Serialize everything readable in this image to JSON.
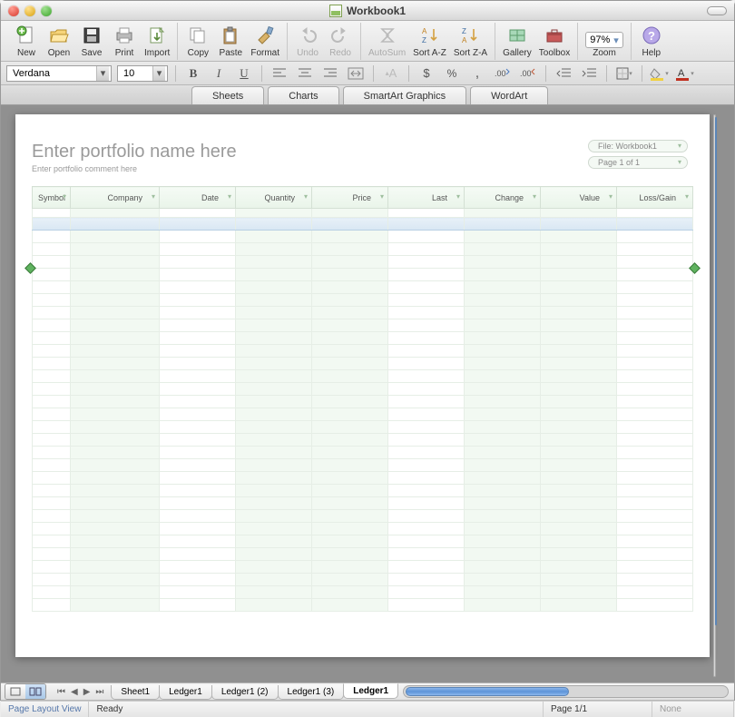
{
  "window": {
    "title": "Workbook1"
  },
  "toolbar": {
    "new": "New",
    "open": "Open",
    "save": "Save",
    "print": "Print",
    "import": "Import",
    "copy": "Copy",
    "paste": "Paste",
    "format": "Format",
    "undo": "Undo",
    "redo": "Redo",
    "autosum": "AutoSum",
    "sortaz": "Sort A-Z",
    "sortza": "Sort Z-A",
    "gallery": "Gallery",
    "toolbox": "Toolbox",
    "zoom": "Zoom",
    "zoom_value": "97%",
    "help": "Help"
  },
  "format": {
    "font": "Verdana",
    "size": "10"
  },
  "toptabs": {
    "sheets": "Sheets",
    "charts": "Charts",
    "smartart": "SmartArt Graphics",
    "wordart": "WordArt"
  },
  "page": {
    "title": "Enter portfolio name here",
    "subtitle": "Enter portfolio comment here",
    "meta_file": "File: Workbook1",
    "meta_page": "Page 1 of 1"
  },
  "columns": {
    "symbol": "Symbol",
    "company": "Company",
    "date": "Date",
    "quantity": "Quantity",
    "price": "Price",
    "last": "Last",
    "change": "Change",
    "value": "Value",
    "lossgain": "Loss/Gain"
  },
  "sheets": {
    "s1": "Sheet1",
    "s2": "Ledger1",
    "s3": "Ledger1 (2)",
    "s4": "Ledger1 (3)",
    "s5": "Ledger1"
  },
  "footer": {
    "viewmode": "Page Layout View",
    "status": "Ready",
    "pageinfo": "Page 1/1",
    "none": "None"
  }
}
